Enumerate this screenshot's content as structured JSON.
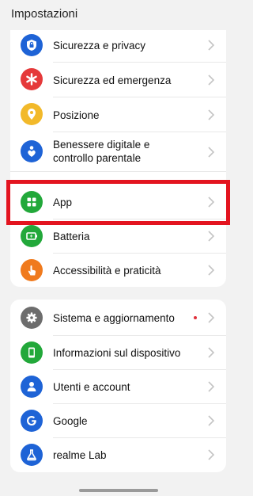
{
  "header": {
    "title": "Impostazioni"
  },
  "colors": {
    "highlight": "#e3141f",
    "notification_dot": "#e0303b"
  },
  "group1": {
    "items": [
      {
        "label": "Sicurezza e privacy",
        "icon": "lock-shield-icon",
        "color": "#1e63d6"
      },
      {
        "label": "Sicurezza ed emergenza",
        "icon": "asterisk-icon",
        "color": "#e5393a"
      },
      {
        "label": "Posizione",
        "icon": "location-pin-icon",
        "color": "#f2b92a"
      },
      {
        "label": "Benessere digitale e",
        "label2": "controllo parentale",
        "icon": "wellbeing-icon",
        "color": "#1e63d6"
      },
      {
        "label": "App",
        "icon": "apps-grid-icon",
        "color": "#22a83a"
      },
      {
        "label": "Batteria",
        "icon": "battery-icon",
        "color": "#22a83a"
      },
      {
        "label": "Accessibilità e praticità",
        "icon": "hand-icon",
        "color": "#f07a1d"
      }
    ]
  },
  "group2": {
    "items": [
      {
        "label": "Sistema e aggiornamento",
        "icon": "gear-icon",
        "color": "#6d6d6d",
        "has_dot": true
      },
      {
        "label": "Informazioni sul dispositivo",
        "icon": "phone-icon",
        "color": "#22a83a"
      },
      {
        "label": "Utenti e account",
        "icon": "user-icon",
        "color": "#1e63d6"
      },
      {
        "label": "Google",
        "icon": "google-icon",
        "color": "#1e63d6"
      },
      {
        "label": "realme Lab",
        "icon": "flask-icon",
        "color": "#1e63d6"
      }
    ]
  }
}
